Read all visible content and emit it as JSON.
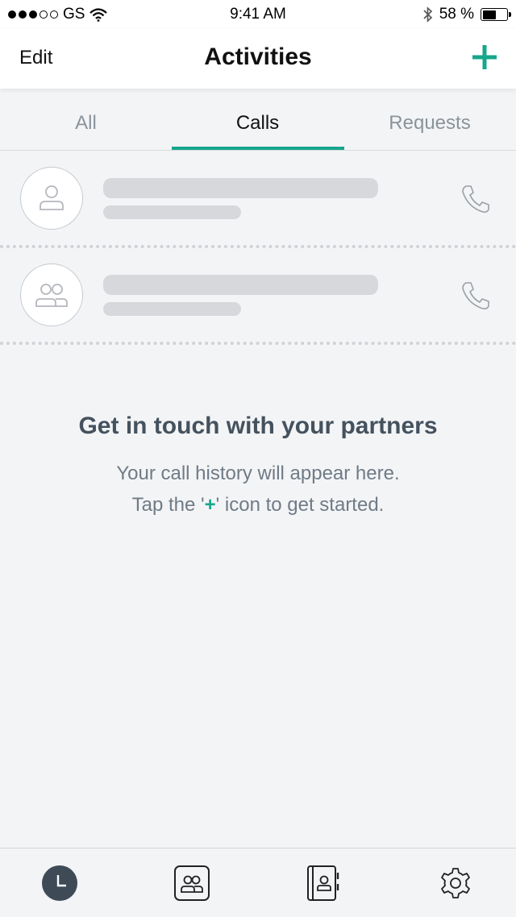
{
  "status_bar": {
    "carrier": "GS",
    "time": "9:41 AM",
    "battery": "58 %",
    "battery_level": 0.58,
    "icons": [
      "signal-dots-icon",
      "wifi-icon",
      "bluetooth-icon",
      "battery-icon"
    ]
  },
  "header": {
    "edit_label": "Edit",
    "title": "Activities",
    "add_icon": "plus-icon"
  },
  "tabs": [
    {
      "label": "All",
      "active": false
    },
    {
      "label": "Calls",
      "active": true
    },
    {
      "label": "Requests",
      "active": false
    }
  ],
  "placeholder_rows": [
    {
      "avatar_icon": "person-icon",
      "action_icon": "phone-icon"
    },
    {
      "avatar_icon": "group-icon",
      "action_icon": "phone-icon"
    }
  ],
  "empty_state": {
    "title": "Get in touch with your partners",
    "line1": "Your call history will appear here.",
    "line2_before": "Tap the '",
    "line2_plus": "+",
    "line2_after": "' icon to get started."
  },
  "bottom_tabs": [
    {
      "icon": "clock-icon",
      "active": true
    },
    {
      "icon": "contacts-icon",
      "active": false
    },
    {
      "icon": "address-book-icon",
      "active": false
    },
    {
      "icon": "gear-icon",
      "active": false
    }
  ],
  "colors": {
    "accent": "#16a68c",
    "dark_text": "#44525e",
    "muted_text": "#6f7b86",
    "placeholder": "#d6d8db",
    "background": "#f3f4f6"
  }
}
